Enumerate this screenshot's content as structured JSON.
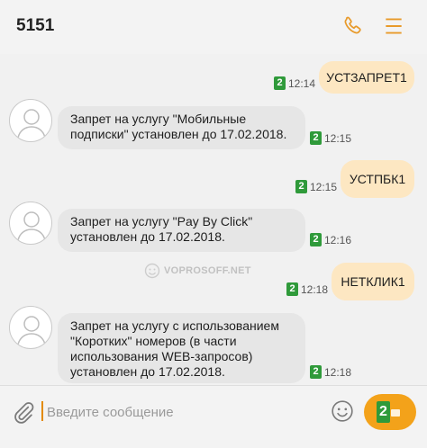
{
  "header": {
    "contact": "5151",
    "phone_icon": "phone-icon",
    "menu_icon": "menu-icon"
  },
  "colors": {
    "accent": "#f3a21a",
    "outgoing_bubble": "#fde7c2",
    "incoming_bubble": "#e6e6e6",
    "sim_badge": "#2f9a3a"
  },
  "messages": [
    {
      "direction": "out",
      "text": "УСТЗАПРЕТ1",
      "sim": "2",
      "time": "12:14"
    },
    {
      "direction": "in",
      "lines": [
        "Запрет на услугу \"Мобильные",
        "подписки\" установлен до 17.02.2018."
      ],
      "sim": "2",
      "time": "12:15"
    },
    {
      "direction": "out",
      "text": "УСТПБК1",
      "sim": "2",
      "time": "12:15"
    },
    {
      "direction": "in",
      "lines": [
        "Запрет на услугу \"Pay By Click\"",
        "установлен до 17.02.2018."
      ],
      "sim": "2",
      "time": "12:16"
    },
    {
      "direction": "out",
      "text": "НЕТКЛИК1",
      "sim": "2",
      "time": "12:18"
    },
    {
      "direction": "in",
      "lines": [
        "Запрет на услугу с использованием",
        "\"Коротких\" номеров (в части",
        "использования WEB-запросов)",
        "установлен до 17.02.2018."
      ],
      "sim": "2",
      "time": "12:18"
    }
  ],
  "watermark": "VOPROSOFF.NET",
  "composer": {
    "placeholder": "Введите сообщение",
    "send_sim": "2"
  }
}
